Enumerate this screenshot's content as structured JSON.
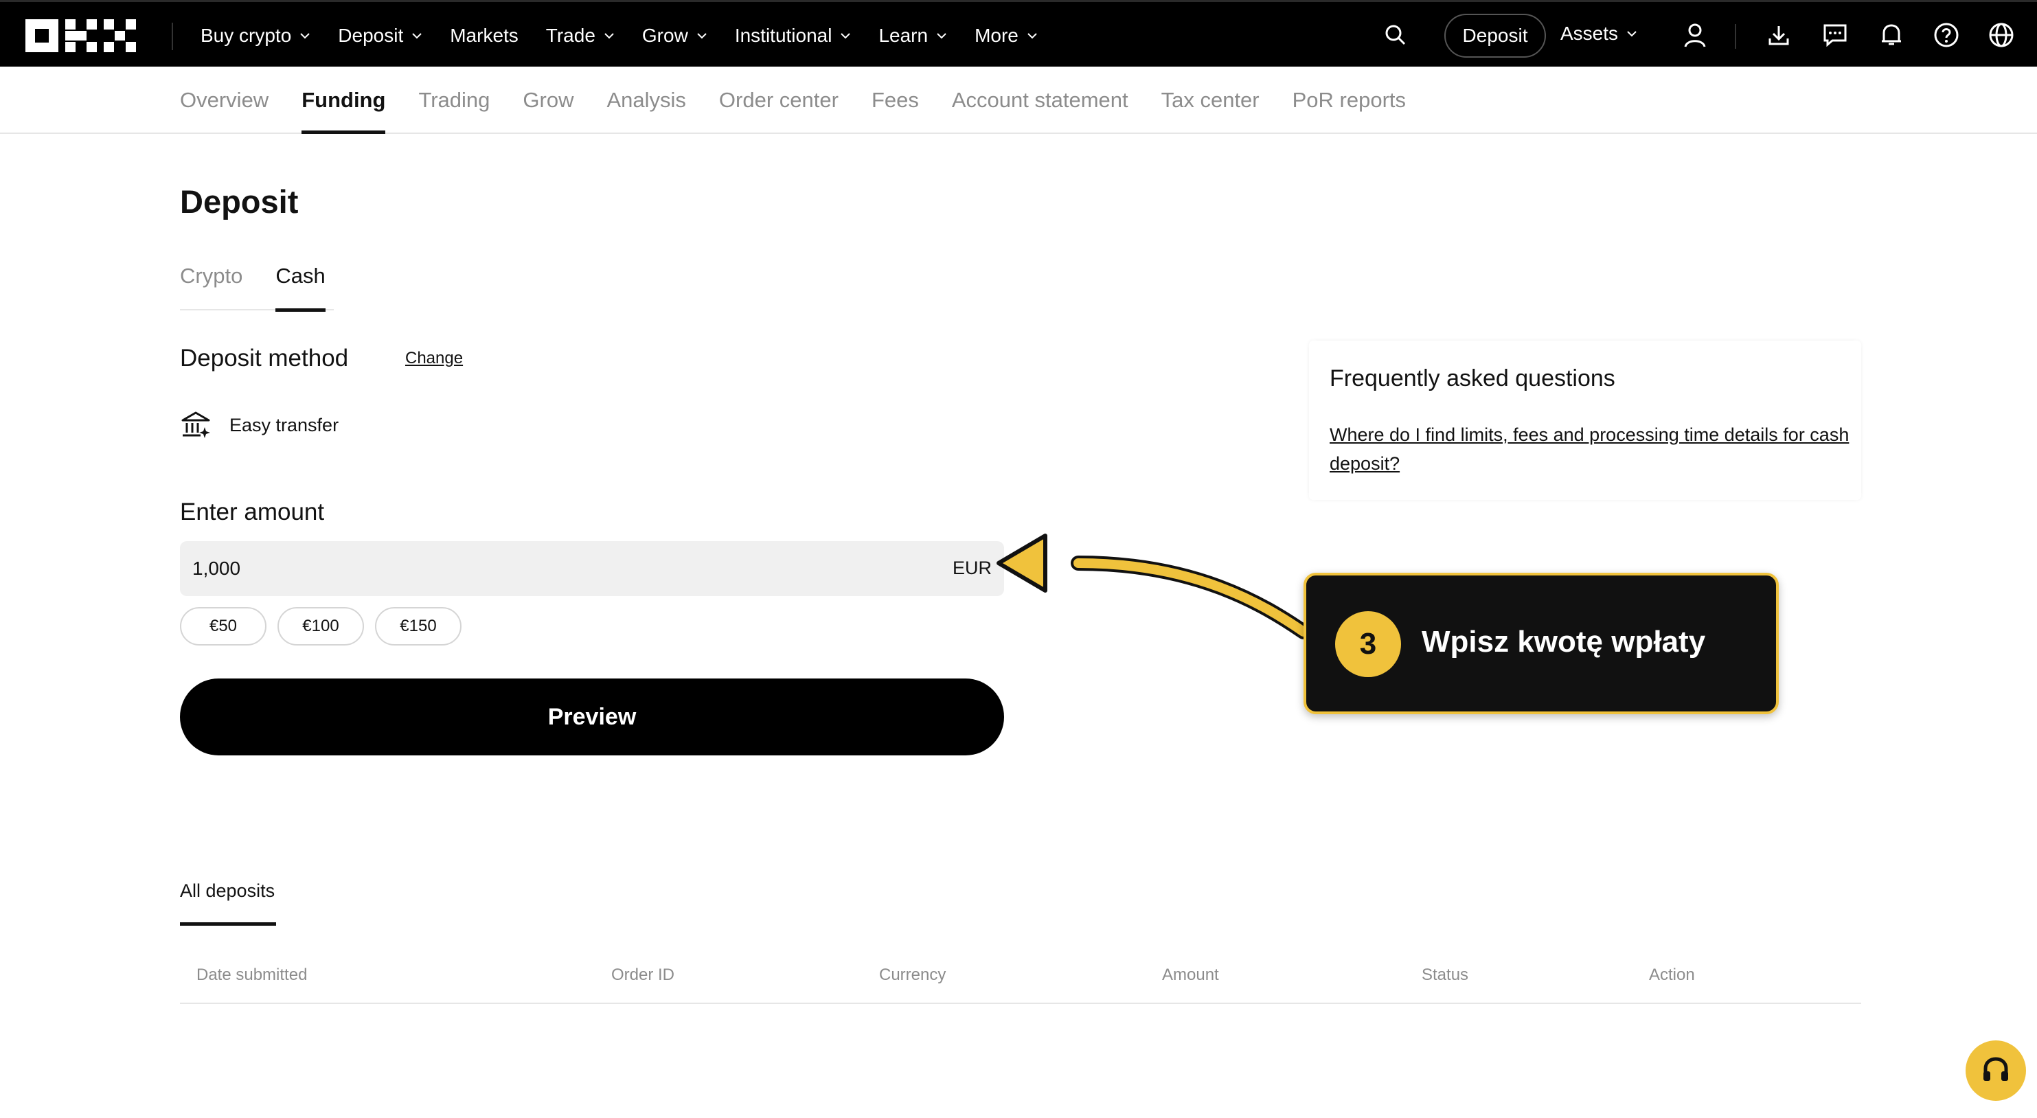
{
  "topnav": {
    "logo_name": "OKX",
    "items": [
      {
        "label": "Buy crypto",
        "dropdown": true
      },
      {
        "label": "Deposit",
        "dropdown": true
      },
      {
        "label": "Markets",
        "dropdown": false
      },
      {
        "label": "Trade",
        "dropdown": true
      },
      {
        "label": "Grow",
        "dropdown": true
      },
      {
        "label": "Institutional",
        "dropdown": true
      },
      {
        "label": "Learn",
        "dropdown": true
      },
      {
        "label": "More",
        "dropdown": true
      }
    ],
    "deposit_button": "Deposit",
    "assets_label": "Assets",
    "icons": [
      "search-icon",
      "user-icon",
      "download-icon",
      "chat-icon",
      "bell-icon",
      "help-icon",
      "globe-icon"
    ]
  },
  "subnav": {
    "items": [
      "Overview",
      "Funding",
      "Trading",
      "Grow",
      "Analysis",
      "Order center",
      "Fees",
      "Account statement",
      "Tax center",
      "PoR reports"
    ],
    "active": "Funding"
  },
  "page": {
    "title": "Deposit",
    "tabs": [
      "Crypto",
      "Cash"
    ],
    "active_tab": "Cash",
    "deposit_method_label": "Deposit method",
    "change_label": "Change",
    "method_name": "Easy transfer",
    "enter_amount_label": "Enter amount",
    "amount_value": "1,000",
    "currency": "EUR",
    "quick_amounts": [
      "€50",
      "€100",
      "€150"
    ],
    "preview_label": "Preview"
  },
  "faq": {
    "title": "Frequently asked questions",
    "link": "Where do I find limits, fees and processing time details for cash deposit?"
  },
  "callout": {
    "step": "3",
    "text": "Wpisz kwotę wpłaty",
    "accent": "#f0c23c"
  },
  "deposits": {
    "tab_label": "All deposits",
    "columns": [
      "Date submitted",
      "Order ID",
      "Currency",
      "Amount",
      "Status",
      "Action"
    ]
  },
  "colors": {
    "nav_bg": "#000000",
    "text_primary": "#121212",
    "text_muted": "#8c8c8c",
    "input_bg": "#f0f0f0",
    "support_button": "#f0c23c"
  }
}
